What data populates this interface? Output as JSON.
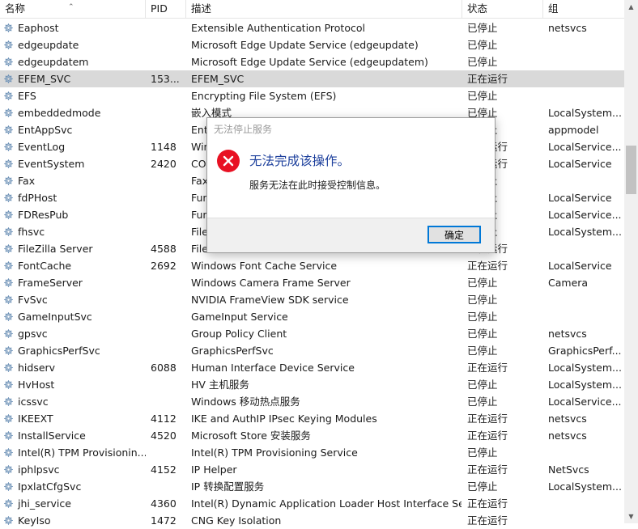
{
  "table": {
    "columns": {
      "name": "名称",
      "pid": "PID",
      "description": "描述",
      "status": "状态",
      "group": "组"
    },
    "selected_index": 3,
    "rows": [
      {
        "name": "Eaphost",
        "pid": "",
        "description": "Extensible Authentication Protocol",
        "status": "已停止",
        "group": "netsvcs"
      },
      {
        "name": "edgeupdate",
        "pid": "",
        "description": "Microsoft Edge Update Service (edgeupdate)",
        "status": "已停止",
        "group": ""
      },
      {
        "name": "edgeupdatem",
        "pid": "",
        "description": "Microsoft Edge Update Service (edgeupdatem)",
        "status": "已停止",
        "group": ""
      },
      {
        "name": "EFEM_SVC",
        "pid": "153...",
        "description": "EFEM_SVC",
        "status": "正在运行",
        "group": ""
      },
      {
        "name": "EFS",
        "pid": "",
        "description": "Encrypting File System (EFS)",
        "status": "已停止",
        "group": ""
      },
      {
        "name": "embeddedmode",
        "pid": "",
        "description": "嵌入模式",
        "status": "已停止",
        "group": "LocalSystem..."
      },
      {
        "name": "EntAppSvc",
        "pid": "",
        "description": "Enterprise App Management Service",
        "status": "已停止",
        "group": "appmodel"
      },
      {
        "name": "EventLog",
        "pid": "1148",
        "description": "Windows Event Log",
        "status": "正在运行",
        "group": "LocalService..."
      },
      {
        "name": "EventSystem",
        "pid": "2420",
        "description": "COM+ Event System",
        "status": "正在运行",
        "group": "LocalService"
      },
      {
        "name": "Fax",
        "pid": "",
        "description": "Fax",
        "status": "已停止",
        "group": ""
      },
      {
        "name": "fdPHost",
        "pid": "",
        "description": "Function Discovery Provider Host",
        "status": "已停止",
        "group": "LocalService"
      },
      {
        "name": "FDResPub",
        "pid": "",
        "description": "Function Discovery Resource Publication",
        "status": "已停止",
        "group": "LocalService..."
      },
      {
        "name": "fhsvc",
        "pid": "",
        "description": "File History Service",
        "status": "已停止",
        "group": "LocalSystem..."
      },
      {
        "name": "FileZilla Server",
        "pid": "4588",
        "description": "FileZilla Server FTP server",
        "status": "正在运行",
        "group": ""
      },
      {
        "name": "FontCache",
        "pid": "2692",
        "description": "Windows Font Cache Service",
        "status": "正在运行",
        "group": "LocalService"
      },
      {
        "name": "FrameServer",
        "pid": "",
        "description": "Windows Camera Frame Server",
        "status": "已停止",
        "group": "Camera"
      },
      {
        "name": "FvSvc",
        "pid": "",
        "description": "NVIDIA FrameView SDK service",
        "status": "已停止",
        "group": ""
      },
      {
        "name": "GameInputSvc",
        "pid": "",
        "description": "GameInput Service",
        "status": "已停止",
        "group": ""
      },
      {
        "name": "gpsvc",
        "pid": "",
        "description": "Group Policy Client",
        "status": "已停止",
        "group": "netsvcs"
      },
      {
        "name": "GraphicsPerfSvc",
        "pid": "",
        "description": "GraphicsPerfSvc",
        "status": "已停止",
        "group": "GraphicsPerf..."
      },
      {
        "name": "hidserv",
        "pid": "6088",
        "description": "Human Interface Device Service",
        "status": "正在运行",
        "group": "LocalSystem..."
      },
      {
        "name": "HvHost",
        "pid": "",
        "description": "HV 主机服务",
        "status": "已停止",
        "group": "LocalSystem..."
      },
      {
        "name": "icssvc",
        "pid": "",
        "description": "Windows 移动热点服务",
        "status": "已停止",
        "group": "LocalService..."
      },
      {
        "name": "IKEEXT",
        "pid": "4112",
        "description": "IKE and AuthIP IPsec Keying Modules",
        "status": "正在运行",
        "group": "netsvcs"
      },
      {
        "name": "InstallService",
        "pid": "4520",
        "description": "Microsoft Store 安装服务",
        "status": "正在运行",
        "group": "netsvcs"
      },
      {
        "name": "Intel(R) TPM Provisionin...",
        "pid": "",
        "description": "Intel(R) TPM Provisioning Service",
        "status": "已停止",
        "group": ""
      },
      {
        "name": "iphlpsvc",
        "pid": "4152",
        "description": "IP Helper",
        "status": "正在运行",
        "group": "NetSvcs"
      },
      {
        "name": "IpxlatCfgSvc",
        "pid": "",
        "description": "IP 转换配置服务",
        "status": "已停止",
        "group": "LocalSystem..."
      },
      {
        "name": "jhi_service",
        "pid": "4360",
        "description": "Intel(R) Dynamic Application Loader Host Interface Ser...",
        "status": "正在运行",
        "group": ""
      },
      {
        "name": "KeyIso",
        "pid": "1472",
        "description": "CNG Key Isolation",
        "status": "正在运行",
        "group": ""
      }
    ]
  },
  "dialog": {
    "title": "无法停止服务",
    "heading": "无法完成该操作。",
    "message": "服务无法在此时接受控制信息。",
    "ok_label": "确定",
    "icon": "error-icon"
  },
  "colors": {
    "selected_row": "#d9d9d9",
    "error_red": "#e81123",
    "heading_blue": "#1c3f9c",
    "button_border": "#0078d7"
  }
}
